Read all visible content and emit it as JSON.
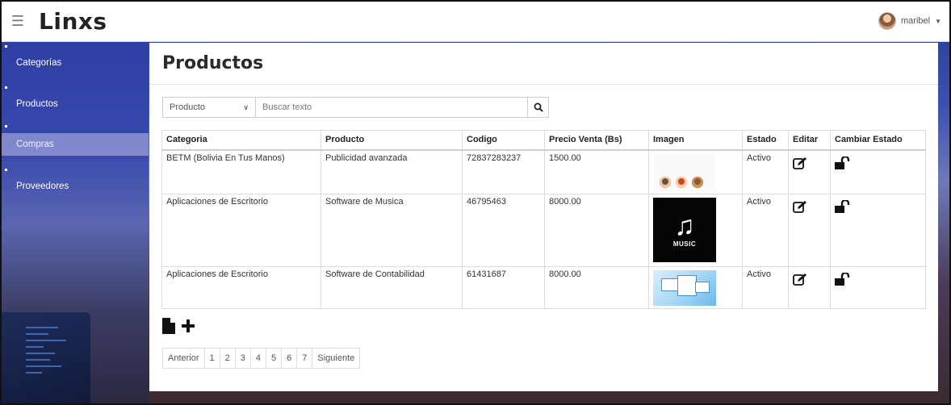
{
  "header": {
    "brand": "Linxs",
    "user_name": "maribel"
  },
  "sidebar": {
    "items": [
      {
        "label": "Categorías"
      },
      {
        "label": "Productos"
      },
      {
        "label": "Compras"
      },
      {
        "label": "Proveedores"
      }
    ]
  },
  "page": {
    "title": "Productos"
  },
  "search": {
    "select_value": "Producto",
    "placeholder": "Buscar texto"
  },
  "table": {
    "headers": [
      "Categoria",
      "Producto",
      "Codigo",
      "Precio Venta (Bs)",
      "Imagen",
      "Estado",
      "Editar",
      "Cambiar Estado"
    ],
    "rows": [
      {
        "categoria": "BETM (Bolivia En Tus Manos)",
        "producto": "Publicidad avanzada",
        "codigo": "72837283237",
        "precio": "1500.00",
        "estado": "Activo"
      },
      {
        "categoria": "Aplicaciones de Escritorio",
        "producto": "Software de Musica",
        "codigo": "46795463",
        "precio": "8000.00",
        "estado": "Activo"
      },
      {
        "categoria": "Aplicaciones de Escritorio",
        "producto": "Software de Contabilidad",
        "codigo": "61431687",
        "precio": "8000.00",
        "estado": "Activo"
      }
    ]
  },
  "image_labels": {
    "music": "MUSIC"
  },
  "pagination": {
    "prev": "Anterior",
    "pages": [
      "1",
      "2",
      "3",
      "4",
      "5",
      "6",
      "7"
    ],
    "next": "Siguiente"
  },
  "icons": {
    "menu": "hamburger-icon",
    "search": "search-icon",
    "edit": "edit-icon",
    "unlock": "unlock-icon",
    "file": "file-icon",
    "add": "plus-icon"
  }
}
